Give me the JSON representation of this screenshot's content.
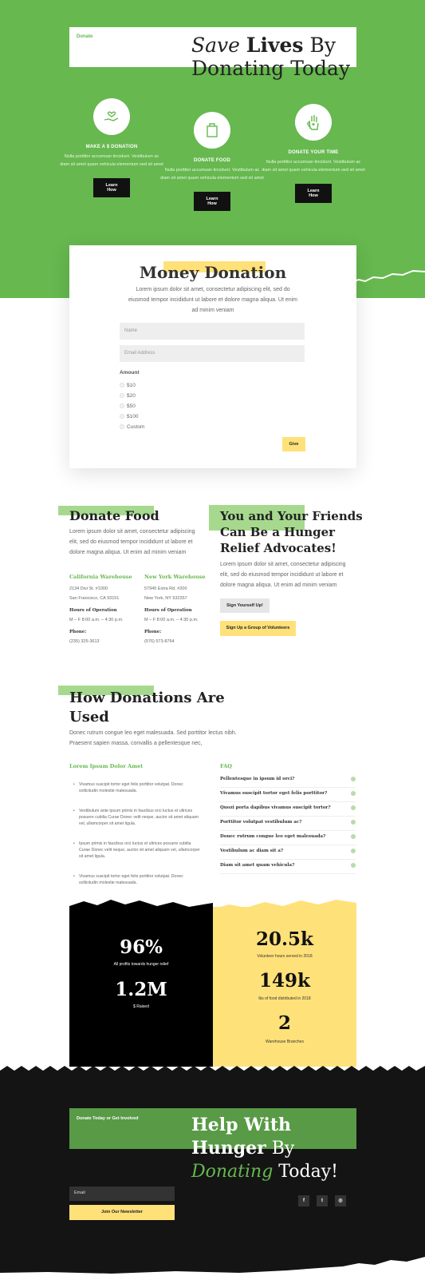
{
  "hero": {
    "tag": "Donate",
    "title_save": "Save ",
    "title_lives": "Lives",
    "title_by": " By",
    "title_line2": "Donating Today"
  },
  "features": [
    {
      "title": "MAKE A $ DONATION",
      "text": "Nulla porttitor accumsan tincidunt. Vestibulum ac diam sit amet quam vehicula elementum sed sit amet",
      "button": "Learn How",
      "icon": "hand-heart-icon"
    },
    {
      "title": "DONATE FOOD",
      "text": "Nulla porttitor accumsan tincidunt. Vestibulum ac diam sit amet quam vehicula elementum sed sit amet",
      "button": "Learn How",
      "icon": "food-bag-icon"
    },
    {
      "title": "DONATE YOUR TIME",
      "text": "Nulla porttitor accumsan tincidunt. Vestibulum ac diam sit amet quam vehicula elementum sed sit amet",
      "button": "Learn How",
      "icon": "raised-hand-icon"
    }
  ],
  "money": {
    "title": "Money Donation",
    "desc": "Lorem ipsum dolor sit amet, consectetur adipiscing elit, sed do eiusmod tempor incididunt ut labore et dolore magna aliqua. Ut enim ad minim veniam",
    "name_placeholder": "Name",
    "email_placeholder": "Email Address",
    "amount_label": "Amount",
    "options": [
      "$10",
      "$20",
      "$50",
      "$100",
      "Custom"
    ],
    "give": "Give"
  },
  "food": {
    "title": "Donate Food",
    "desc": "Lorem ipsum dolor sit amet, consectetur adipiscing elit, sed do eiusmod tempor incididunt ut labore et dolore magna aliqua. Ut enim ad minim veniam",
    "warehouses": [
      {
        "name": "California Warehouse",
        "addr1": "2134 Divi St. #1000",
        "addr2": "San Francisco, CA 93151",
        "hours_label": "Hours of Operation",
        "hours": "M – F 8:00 a.m. – 4:30 p.m.",
        "phone_label": "Phone:",
        "phone": "(235) 325-3613"
      },
      {
        "name": "New York Warehouse",
        "addr1": "57945 Extra Rd. #200",
        "addr2": "New York, NY 532357",
        "hours_label": "Hours of Operation",
        "hours": "M – F 8:00 a.m. – 4:30 p.m.",
        "phone_label": "Phone:",
        "phone": "(576) 573-8764"
      }
    ]
  },
  "friends": {
    "title": "You and Your Friends Can Be a Hunger Relief Advocates!",
    "desc": "Lorem ipsum dolor sit amet, consectetur adipiscing elit, sed do eiusmod tempor incididunt ut labore et dolore magna aliqua. Ut enim ad minim veniam",
    "btn_signup": "Sign Yourself Up!",
    "btn_group": "Sign Up a Group of Volunteers"
  },
  "how": {
    "title": "How Donations Are Used",
    "desc": "Donec rutrum congue leo eget malesuada. Sed porttitor lectus nibh. Praesent sapien massa, convallis a pellentesque nec,",
    "list_title": "Lorem Ipsum Dolor Amet",
    "bullets": [
      "Vivamus suscipit tortor eget felis porttitor volutpat. Donec sollicitudin molestie malesuada.",
      "Vestibulum ante ipsum primis in faucibus orci luctus et ultrices posuere cubilia Curae Donec velit neque, auctor sit amet aliquam vel, ullamcorper sit amet ligula.",
      "Ipsum primis in faucibus orci luctus et ultrices posuere cubilia Curae Donec velit neque, auctor sit amet aliquam vel, ullamcorper sit amet ligula.",
      "Vivamus suscipit tortor eget felis porttitor volutpat. Donec sollicitudin molestie malesuada."
    ],
    "faq_title": "FAQ",
    "faq": [
      "Pellentesque in ipsum id orci?",
      "Vivamus suscipit tortor eget felis porttitor?",
      "Quozi porta dapibus vivamus suscipit tortor?",
      "Porttitor volutpat vestibulum ac?",
      "Donec rutrum congue leo eget malesuada?",
      "Vestibulum ac diam sit a?",
      "Diam sit amet quam vehicula?"
    ]
  },
  "stats": {
    "left": [
      {
        "num": "96%",
        "label": "All profits towards hunger relief"
      },
      {
        "num": "1.2M",
        "label": "$ Raised"
      }
    ],
    "right": [
      {
        "num": "20.5k",
        "label": "Volunteer hours served in 2018"
      },
      {
        "num": "149k",
        "label": "lbs of food distributed in 2018"
      },
      {
        "num": "2",
        "label": "Warehouse Branches"
      }
    ]
  },
  "footer": {
    "tag": "Donate Today or Get Involved",
    "title_line1": "Help With",
    "title_line2a": "Hunger",
    "title_line2b": " By",
    "title_line3a": "Donating",
    "title_line3b": " Today!",
    "email_placeholder": "Email",
    "newsletter": "Join Our Newsletter",
    "social": [
      {
        "icon": "facebook-icon",
        "glyph": "f"
      },
      {
        "icon": "twitter-icon",
        "glyph": "t"
      },
      {
        "icon": "instagram-icon",
        "glyph": "◎"
      }
    ]
  },
  "colors": {
    "green": "#66b84f",
    "yellow": "#ffe17a",
    "dark": "#141414"
  }
}
